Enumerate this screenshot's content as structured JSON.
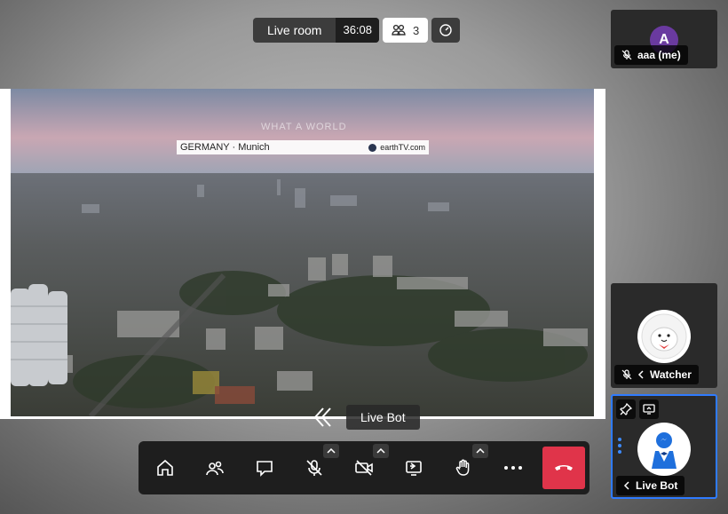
{
  "header": {
    "room_name": "Live room",
    "timer": "36:08",
    "participant_count": "3"
  },
  "video": {
    "watermark": "WHAT A WORLD",
    "location_caption": "GERMANY · Munich",
    "brand": "earthTV.com"
  },
  "participants": [
    {
      "initial": "A",
      "name": "aaa (me)",
      "avatar_color": "#6a3aa0",
      "muted": true
    },
    {
      "name": "Watcher",
      "muted": true
    },
    {
      "name": "Live Bot",
      "active_speaker": true
    }
  ],
  "speaker_label": "Live Bot",
  "toolbar": {
    "buttons": [
      "home-icon",
      "participants-icon",
      "chat-icon",
      "microphone-off-icon",
      "camera-off-icon",
      "share-screen-icon",
      "raise-hand-icon",
      "more-icon",
      "hang-up-icon"
    ],
    "hangup_color": "#e0344a"
  },
  "colors": {
    "active_border": "#2f7bff",
    "tile_background": "#2a2a2a",
    "toolbar_background": "#1e1e1e"
  }
}
